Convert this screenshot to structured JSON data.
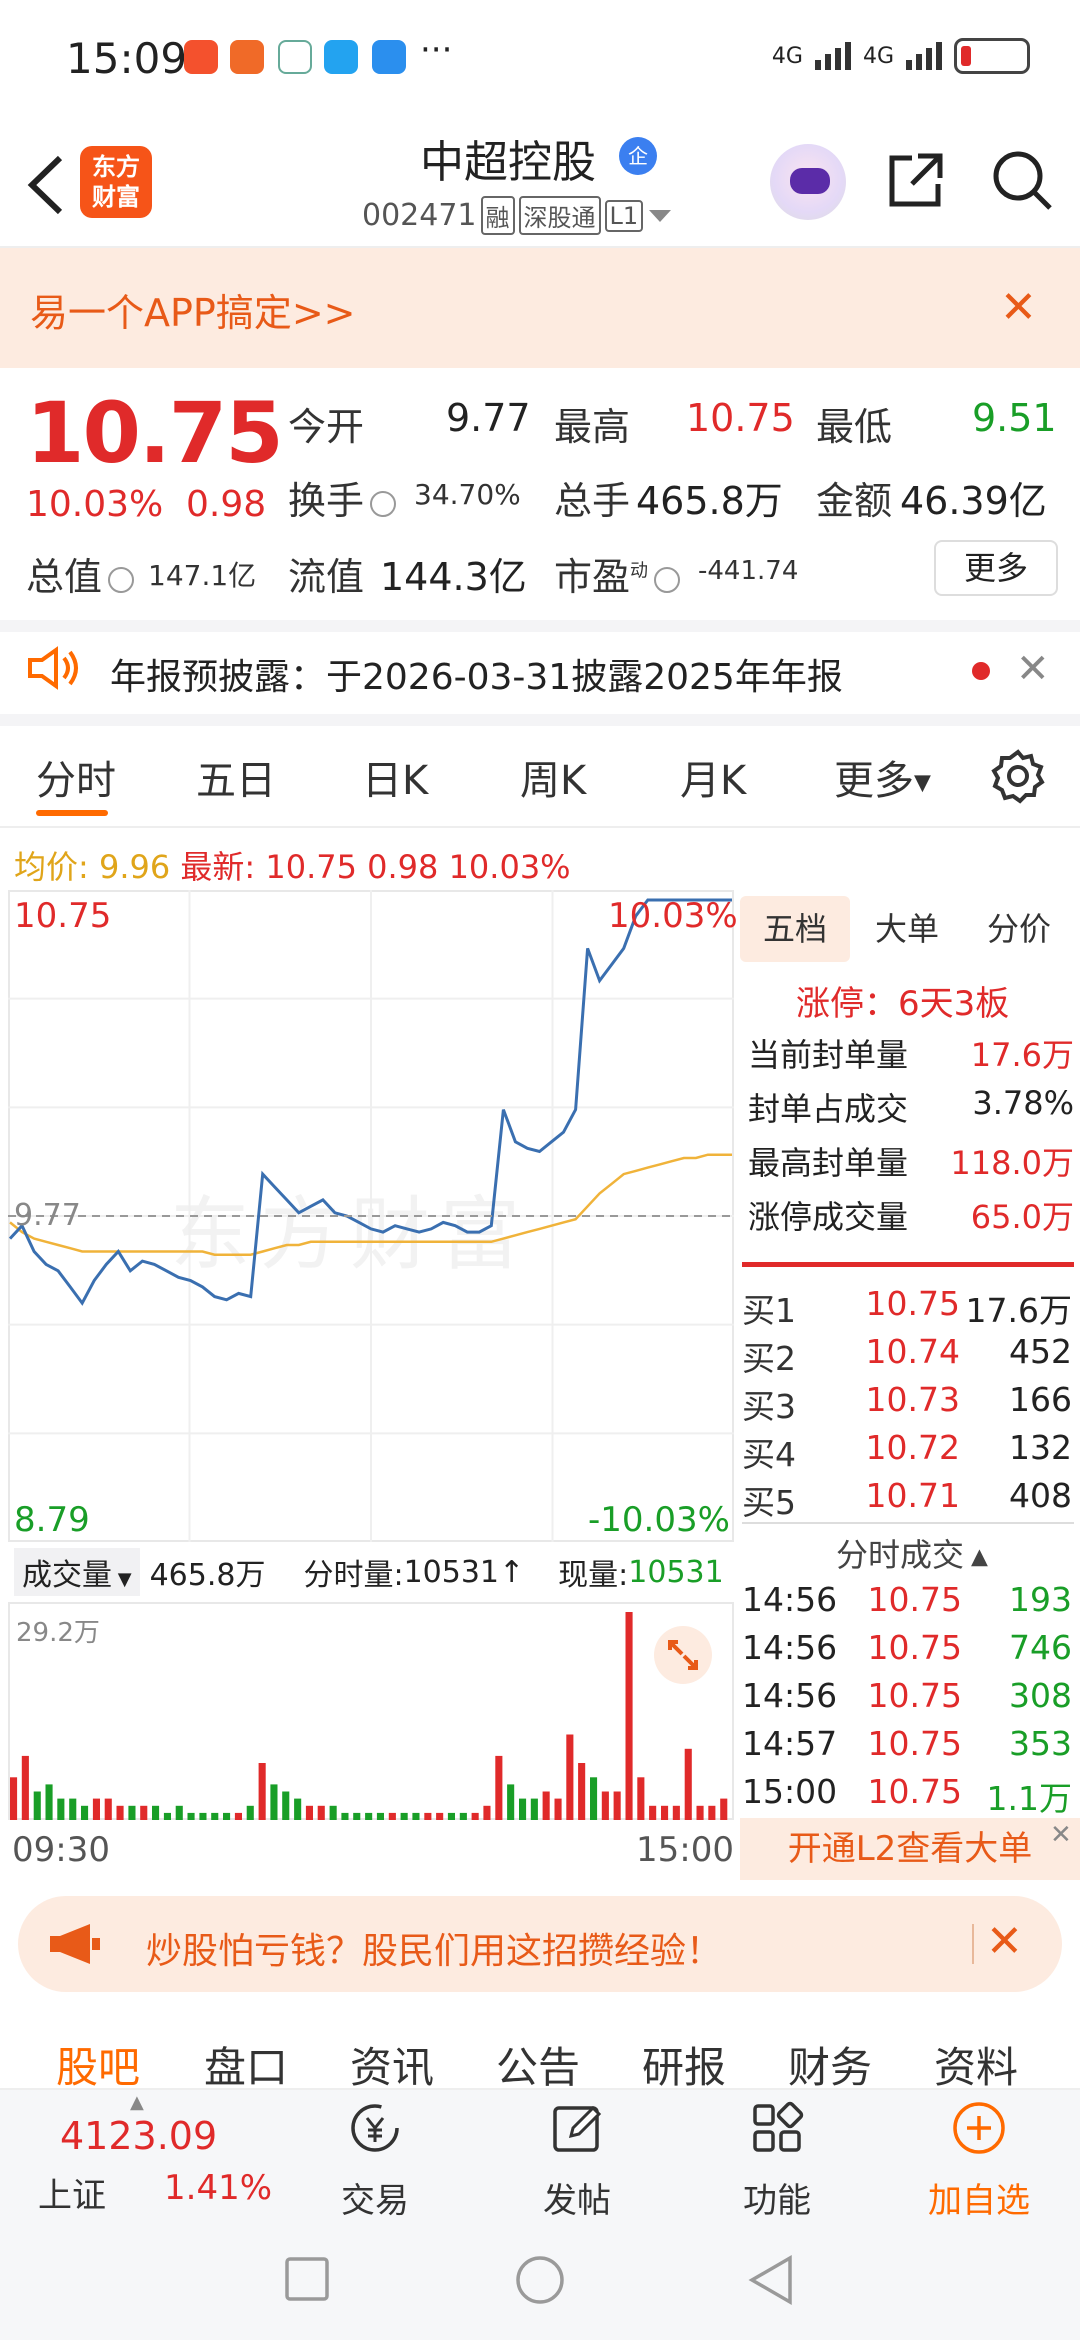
{
  "status_bar": {
    "time": "15:09",
    "more": "···",
    "net1": "4G",
    "net2": "4G"
  },
  "header": {
    "app_logo": "东方\n财富",
    "stock_name": "中超控股",
    "verified_badge": "企",
    "code": "002471",
    "tags": [
      "融",
      "深股通",
      "L1"
    ]
  },
  "banner": {
    "text": "易一个APP搞定>>"
  },
  "quote": {
    "price": "10.75",
    "change_pct": "10.03%",
    "change_abs": "0.98",
    "open_label": "今开",
    "open": "9.77",
    "high_label": "最高",
    "high": "10.75",
    "low_label": "最低",
    "low": "9.51",
    "turnover_label": "换手",
    "turnover": "34.70%",
    "volume_label": "总手",
    "volume": "465.8万",
    "amount_label": "金额",
    "amount": "46.39亿",
    "mktcap_label": "总值",
    "mktcap": "147.1亿",
    "float_label": "流值",
    "float": "144.3亿",
    "pe_label": "市盈",
    "pe_sup": "动",
    "pe": "-441.74",
    "more_button": "更多"
  },
  "notice": {
    "text": "年报预披露：于2026-03-31披露2025年年报"
  },
  "chart_tabs": [
    "分时",
    "五日",
    "日K",
    "周K",
    "月K",
    "更多"
  ],
  "avg_row": {
    "avg_label": "均价:",
    "avg": "9.96",
    "latest_label": "最新:",
    "latest": "10.75",
    "chg": "0.98",
    "pct": "10.03%"
  },
  "chart_labels": {
    "top_price": "10.75",
    "top_pct": "10.03%",
    "ref_price": "9.77",
    "bottom_price": "8.79",
    "bottom_pct": "-10.03%",
    "time_start": "09:30",
    "time_end": "15:00",
    "watermark": "东方财富"
  },
  "volume_bar": {
    "selector": "成交量",
    "total": "465.8万",
    "minute_label": "分时量:",
    "minute_val": "10531↑",
    "current_label": "现量:",
    "current_val": "10531",
    "max_label": "29.2万"
  },
  "right_panel": {
    "tabs": [
      "五档",
      "大单",
      "分价"
    ],
    "limit_up": "涨停：6天3板",
    "seal_stats": [
      {
        "label": "当前封单量",
        "value": "17.6万"
      },
      {
        "label": "封单占成交",
        "value": "3.78%"
      },
      {
        "label": "最高封单量",
        "value": "118.0万"
      },
      {
        "label": "涨停成交量",
        "value": "65.0万"
      }
    ],
    "order_book": [
      {
        "label": "买1",
        "price": "10.75",
        "qty": "17.6万"
      },
      {
        "label": "买2",
        "price": "10.74",
        "qty": "452"
      },
      {
        "label": "买3",
        "price": "10.73",
        "qty": "166"
      },
      {
        "label": "买4",
        "price": "10.72",
        "qty": "132"
      },
      {
        "label": "买5",
        "price": "10.71",
        "qty": "408"
      }
    ],
    "trades_title": "分时成交",
    "trades": [
      {
        "time": "14:56",
        "price": "10.75",
        "qty": "193"
      },
      {
        "time": "14:56",
        "price": "10.75",
        "qty": "746"
      },
      {
        "time": "14:56",
        "price": "10.75",
        "qty": "308"
      },
      {
        "time": "14:57",
        "price": "10.75",
        "qty": "353"
      },
      {
        "time": "15:00",
        "price": "10.75",
        "qty": "1.1万"
      }
    ],
    "l2_button": "开通L2查看大单"
  },
  "promo": {
    "text": "炒股怕亏钱？股民们用这招攒经验！"
  },
  "bottom_tabs": [
    "股吧",
    "盘口",
    "资讯",
    "公告",
    "研报",
    "财务",
    "资料"
  ],
  "bottom_nav": {
    "index_value": "4123.09",
    "index_name": "上证",
    "index_pct": "1.41%",
    "items": [
      "交易",
      "发帖",
      "功能",
      "加自选"
    ]
  },
  "colors": {
    "up": "#e02a2a",
    "down": "#199e27",
    "accent": "#ff6a00",
    "price_line": "#3a6fb0",
    "avg_line": "#f0b33a"
  },
  "chart_data": {
    "type": "line",
    "ylim": [
      8.79,
      10.75
    ],
    "reference": 9.77,
    "series": [
      {
        "values": [
          9.7,
          9.74,
          9.66,
          9.62,
          9.6,
          9.55,
          9.5,
          9.57,
          9.62,
          9.66,
          9.6,
          9.63,
          9.62,
          9.6,
          9.58,
          9.57,
          9.55,
          9.52,
          9.51,
          9.53,
          9.52,
          9.9,
          9.86,
          9.82,
          9.78,
          9.8,
          9.82,
          9.78,
          9.77,
          9.75,
          9.73,
          9.72,
          9.74,
          9.73,
          9.72,
          9.73,
          9.75,
          9.74,
          9.72,
          9.72,
          9.74,
          10.1,
          10.0,
          9.98,
          9.97,
          10.0,
          10.03,
          10.1,
          10.6,
          10.5,
          10.55,
          10.6,
          10.7,
          10.75,
          10.75,
          10.75,
          10.75,
          10.75,
          10.75,
          10.75,
          10.75
        ]
      },
      {
        "values": [
          9.75,
          9.72,
          9.7,
          9.69,
          9.68,
          9.67,
          9.66,
          9.66,
          9.66,
          9.66,
          9.66,
          9.66,
          9.66,
          9.66,
          9.66,
          9.66,
          9.66,
          9.65,
          9.65,
          9.65,
          9.65,
          9.66,
          9.67,
          9.68,
          9.68,
          9.69,
          9.69,
          9.69,
          9.69,
          9.69,
          9.69,
          9.69,
          9.69,
          9.69,
          9.69,
          9.69,
          9.69,
          9.69,
          9.69,
          9.69,
          9.69,
          9.7,
          9.71,
          9.72,
          9.73,
          9.74,
          9.75,
          9.76,
          9.8,
          9.84,
          9.87,
          9.9,
          9.91,
          9.92,
          9.93,
          9.94,
          9.95,
          9.95,
          9.96,
          9.96,
          9.96
        ]
      }
    ],
    "volume": [
      6,
      9,
      4,
      5,
      3,
      3,
      2,
      3,
      3,
      2,
      2,
      2,
      2,
      1,
      2,
      1,
      1,
      1,
      1,
      1,
      2,
      8,
      5,
      4,
      3,
      2,
      2,
      2,
      1,
      1,
      1,
      1,
      1,
      1,
      1,
      1,
      1,
      1,
      1,
      1,
      2,
      9,
      5,
      3,
      3,
      4,
      3,
      12,
      8,
      6,
      4,
      4,
      29.2,
      6,
      2,
      2,
      2,
      10,
      2,
      2,
      3
    ]
  }
}
